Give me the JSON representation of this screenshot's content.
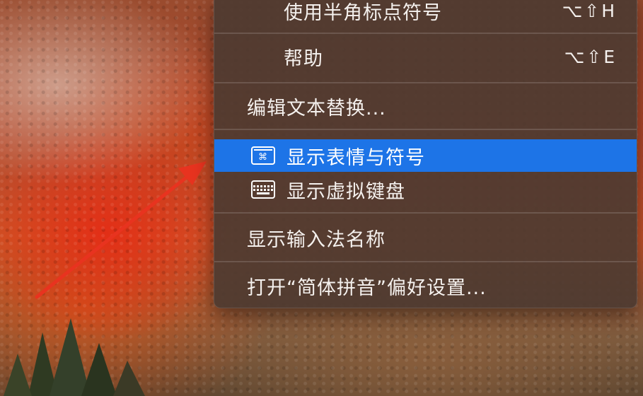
{
  "menu": {
    "items": [
      {
        "label": "使用半角标点符号",
        "shortcut": "⌥⇧H"
      },
      {
        "label": "帮助",
        "shortcut": "⌥⇧E"
      },
      {
        "label": "编辑文本替换..."
      },
      {
        "label": "显示表情与符号",
        "icon": "emoji-keyboard-icon",
        "highlighted": true
      },
      {
        "label": "显示虚拟键盘",
        "icon": "keyboard-icon"
      },
      {
        "label": "显示输入法名称"
      },
      {
        "label": "打开“简体拼音”偏好设置..."
      }
    ],
    "emoji_icon_glyph": "⌘"
  },
  "colors": {
    "menu_background": "#4e3a30",
    "highlight": "#1d74e7",
    "arrow": "#e8331f"
  }
}
